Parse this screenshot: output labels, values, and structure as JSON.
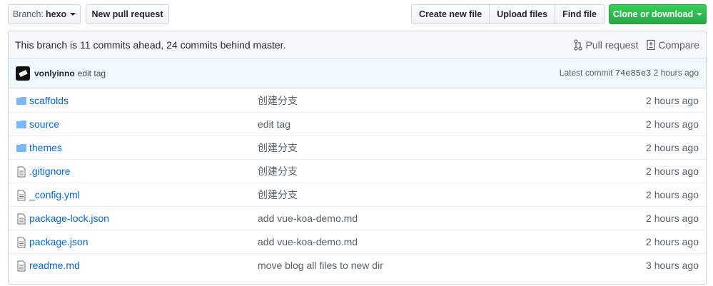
{
  "toolbar": {
    "branch_prefix": "Branch:",
    "branch_name": "hexo",
    "new_pr": "New pull request",
    "create_file": "Create new file",
    "upload_files": "Upload files",
    "find_file": "Find file",
    "clone": "Clone or download"
  },
  "info": {
    "text": "This branch is 11 commits ahead, 24 commits behind master.",
    "pull_request": "Pull request",
    "compare": "Compare"
  },
  "commit": {
    "author": "vonlyinno",
    "message": "edit tag",
    "latest_label": "Latest commit",
    "sha": "74e85e3",
    "age": "2 hours ago"
  },
  "files": [
    {
      "type": "folder",
      "name": "scaffolds",
      "message": "创建分支",
      "age": "2 hours ago"
    },
    {
      "type": "folder",
      "name": "source",
      "message": "edit tag",
      "age": "2 hours ago"
    },
    {
      "type": "folder",
      "name": "themes",
      "message": "创建分支",
      "age": "2 hours ago"
    },
    {
      "type": "file",
      "name": ".gitignore",
      "message": "创建分支",
      "age": "2 hours ago"
    },
    {
      "type": "file",
      "name": "_config.yml",
      "message": "创建分支",
      "age": "2 hours ago"
    },
    {
      "type": "file",
      "name": "package-lock.json",
      "message": "add vue-koa-demo.md",
      "age": "2 hours ago"
    },
    {
      "type": "file",
      "name": "package.json",
      "message": "add vue-koa-demo.md",
      "age": "2 hours ago"
    },
    {
      "type": "file",
      "name": "readme.md",
      "message": "move blog all files to new dir",
      "age": "3 hours ago"
    }
  ],
  "colors": {
    "link": "#0366d6",
    "green_button": "#28a745",
    "folder_icon": "#79b8ff"
  }
}
